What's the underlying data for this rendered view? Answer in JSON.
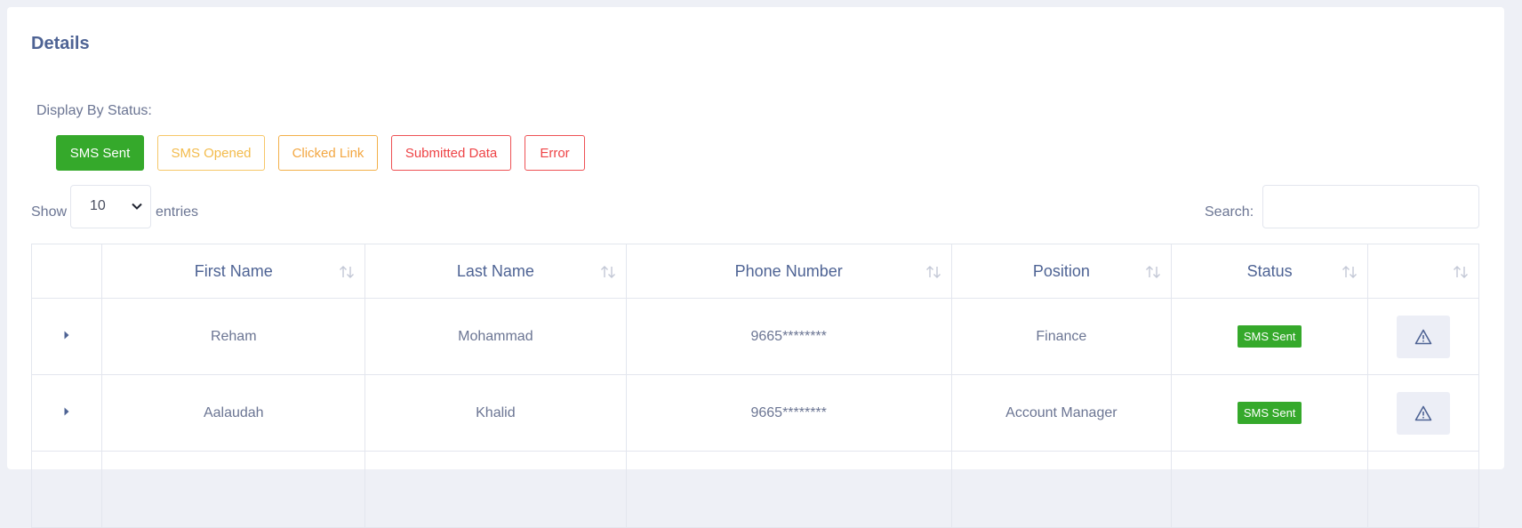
{
  "panel": {
    "title": "Details"
  },
  "filters": {
    "label": "Display By Status:",
    "buttons": [
      "SMS Sent",
      "SMS Opened",
      "Clicked Link",
      "Submitted Data",
      "Error"
    ]
  },
  "length_menu": {
    "show_label": "Show",
    "value": "10",
    "entries_label": "entries"
  },
  "search": {
    "label": "Search:",
    "value": ""
  },
  "table": {
    "columns": [
      "",
      "First Name",
      "Last Name",
      "Phone Number",
      "Position",
      "Status",
      ""
    ],
    "rows": [
      {
        "first_name": "Reham",
        "last_name": "Mohammad",
        "phone": "9665********",
        "position": "Finance",
        "status": "SMS Sent"
      },
      {
        "first_name": "Aalaudah",
        "last_name": "Khalid",
        "phone": "9665********",
        "position": "Account Manager",
        "status": "SMS Sent"
      }
    ]
  },
  "colors": {
    "sent": "#35a92b",
    "opened": "#f3bb4b",
    "clicked": "#f3a742",
    "submitted": "#ee4346",
    "error": "#ee4346",
    "title": "#4e6394"
  },
  "icons": {
    "sort": "sort-arrows-icon",
    "expand": "caret-right-icon",
    "select": "chevron-down-icon",
    "action": "warning-triangle-icon"
  }
}
